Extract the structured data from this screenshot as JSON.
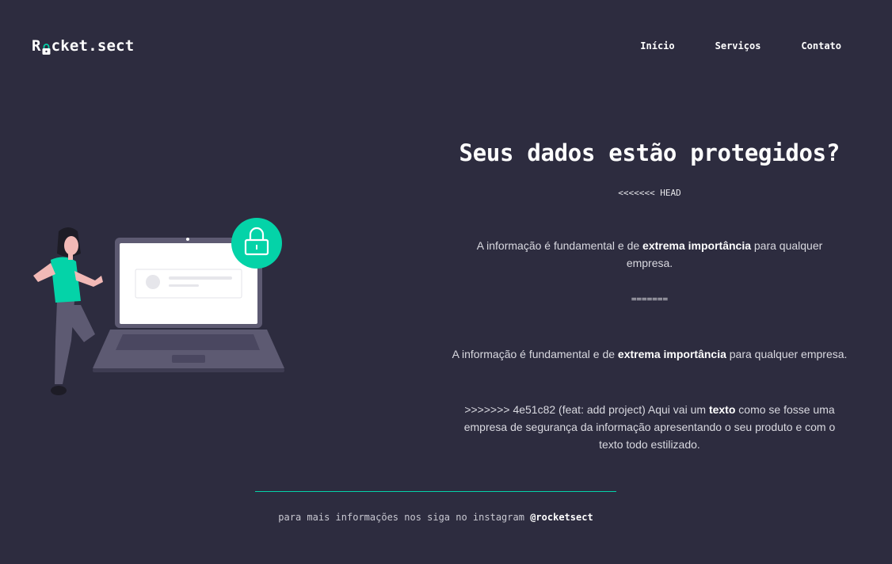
{
  "header": {
    "logo_prefix": "R",
    "logo_suffix": "cket.sect",
    "nav": [
      "Início",
      "Serviços",
      "Contato"
    ]
  },
  "hero": {
    "title": "Seus dados estão protegidos?",
    "head_marker": "<<<<<<< HEAD",
    "para1_pre": "A informação é fundamental e de ",
    "para1_bold": "extrema importância",
    "para1_post": " para qualquer empresa.",
    "separator_marker": "=======",
    "para2_pre": "A informação é fundamental e de ",
    "para2_bold": "extrema importância",
    "para2_post": " para qualquer empresa.",
    "para3_pre": ">>>>>>> 4e51c82 (feat: add project) Aqui vai um ",
    "para3_bold": "texto",
    "para3_post": " como se fosse uma empresa de segurança da informação apresentando o seu produto e com o texto todo estilizado."
  },
  "footer": {
    "text": "para mais informações nos siga no instagram",
    "handle": "@rocketsect"
  },
  "colors": {
    "background": "#2d2c3f",
    "accent": "#04d3a8",
    "laptop": "#5d5a72"
  }
}
